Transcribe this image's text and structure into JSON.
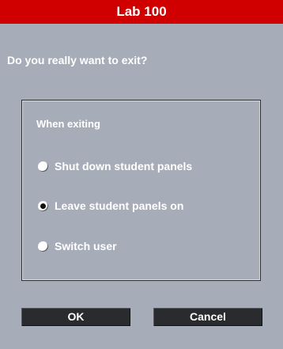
{
  "window": {
    "title": "Lab 100"
  },
  "dialog": {
    "question": "Do you really want to exit?",
    "group": {
      "title": "When exiting",
      "options": [
        {
          "label": "Shut down student panels",
          "selected": false
        },
        {
          "label": "Leave student panels on",
          "selected": true
        },
        {
          "label": "Switch user",
          "selected": false
        }
      ]
    },
    "buttons": {
      "ok_label": "OK",
      "cancel_label": "Cancel"
    }
  },
  "colors": {
    "title_bar": "#d00000",
    "dialog_background": "#a7adb8",
    "button_background": "#2a2b2f",
    "text": "#ffffff"
  }
}
